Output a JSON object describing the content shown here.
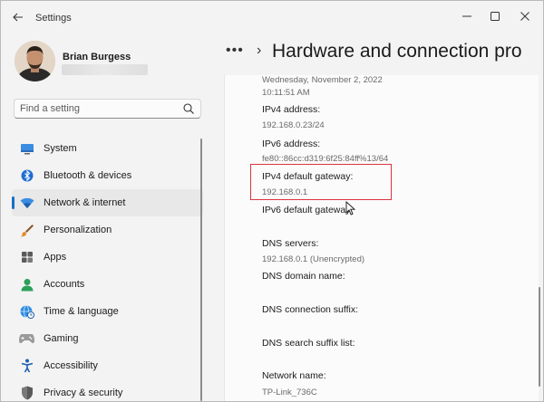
{
  "window": {
    "title": "Settings",
    "back_icon": "arrow-left-icon",
    "min_icon": "minimize-icon",
    "max_icon": "maximize-icon",
    "close_icon": "close-icon"
  },
  "profile": {
    "name": "Brian Burgess"
  },
  "search": {
    "placeholder": "Find a setting",
    "icon": "search-icon"
  },
  "sidebar": {
    "items": [
      {
        "label": "System",
        "icon": "monitor-icon"
      },
      {
        "label": "Bluetooth & devices",
        "icon": "bluetooth-icon"
      },
      {
        "label": "Network & internet",
        "icon": "wifi-icon",
        "active": true
      },
      {
        "label": "Personalization",
        "icon": "paintbrush-icon"
      },
      {
        "label": "Apps",
        "icon": "apps-icon"
      },
      {
        "label": "Accounts",
        "icon": "person-icon"
      },
      {
        "label": "Time & language",
        "icon": "globe-clock-icon"
      },
      {
        "label": "Gaming",
        "icon": "gamepad-icon"
      },
      {
        "label": "Accessibility",
        "icon": "accessibility-icon"
      },
      {
        "label": "Privacy & security",
        "icon": "shield-icon"
      }
    ]
  },
  "header": {
    "more_label": "•••",
    "separator": "›",
    "title": "Hardware and connection pro"
  },
  "details": {
    "lease_date": "Wednesday, November 2, 2022",
    "lease_time": "10:11:51 AM",
    "ipv4_label": "IPv4 address:",
    "ipv4_value": "192.168.0.23/24",
    "ipv6_label": "IPv6 address:",
    "ipv6_value": "fe80::86cc:d319:6f25:84ff%13/64",
    "ipv4_gw_label": "IPv4 default gateway:",
    "ipv4_gw_value": "192.168.0.1",
    "ipv6_gw_label": "IPv6 default gateway:",
    "dns_servers_label": "DNS servers:",
    "dns_servers_value": "192.168.0.1 (Unencrypted)",
    "dns_domain_label": "DNS domain name:",
    "dns_suffix_label": "DNS connection suffix:",
    "dns_search_label": "DNS search suffix list:",
    "network_name_label": "Network name:",
    "network_name_value": "TP-Link_736C"
  },
  "colors": {
    "accent": "#1a6ec7",
    "highlight_box": "#d9343f"
  }
}
